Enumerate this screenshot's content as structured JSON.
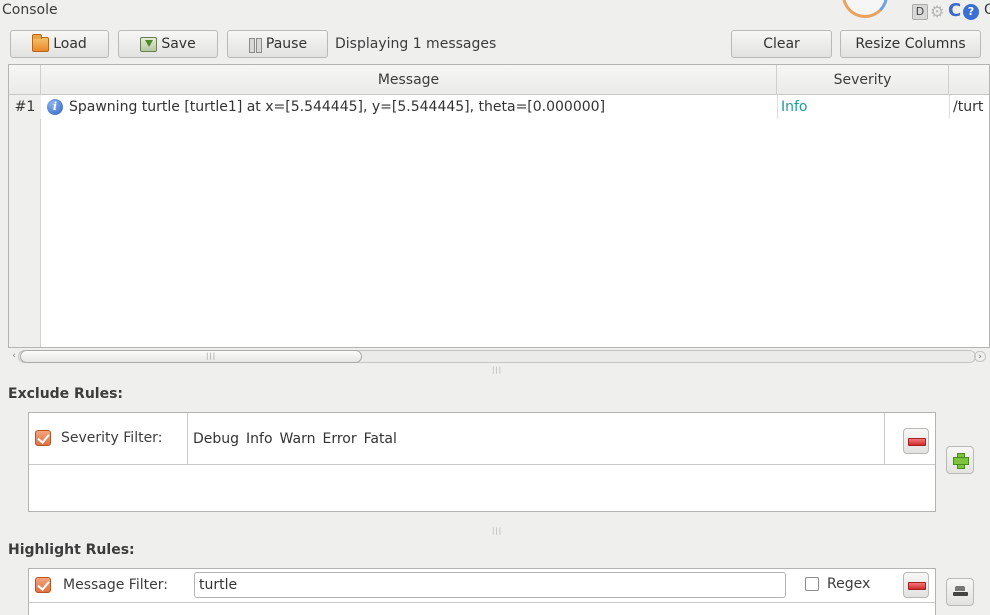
{
  "window": {
    "title": "Console",
    "trailing_letter": "O"
  },
  "toolbar": {
    "load_label": "Load",
    "save_label": "Save",
    "pause_label": "Pause",
    "status_text": "Displaying 1 messages",
    "clear_label": "Clear",
    "resize_label": "Resize Columns"
  },
  "table": {
    "columns": [
      "Message",
      "Severity"
    ],
    "rows": [
      {
        "index": "#1",
        "icon": "info-icon",
        "message": "Spawning turtle [turtle1] at x=[5.544445], y=[5.544445], theta=[0.000000]",
        "severity": "Info",
        "node": "/turt"
      }
    ]
  },
  "exclude": {
    "title": "Exclude Rules:",
    "rule_label": "Severity Filter:",
    "checked": true,
    "severities": [
      "Debug",
      "Info",
      "Warn",
      "Error",
      "Fatal"
    ]
  },
  "highlight": {
    "title": "Highlight Rules:",
    "rule_label": "Message Filter:",
    "checked": true,
    "filter_value": "turtle",
    "regex_label": "Regex",
    "regex_checked": false
  },
  "colors": {
    "severity_info": "#1e9a9a",
    "checkbox_accent": "#e0703f",
    "plus_green": "#7cc43b",
    "minus_red": "#d02c2c"
  }
}
